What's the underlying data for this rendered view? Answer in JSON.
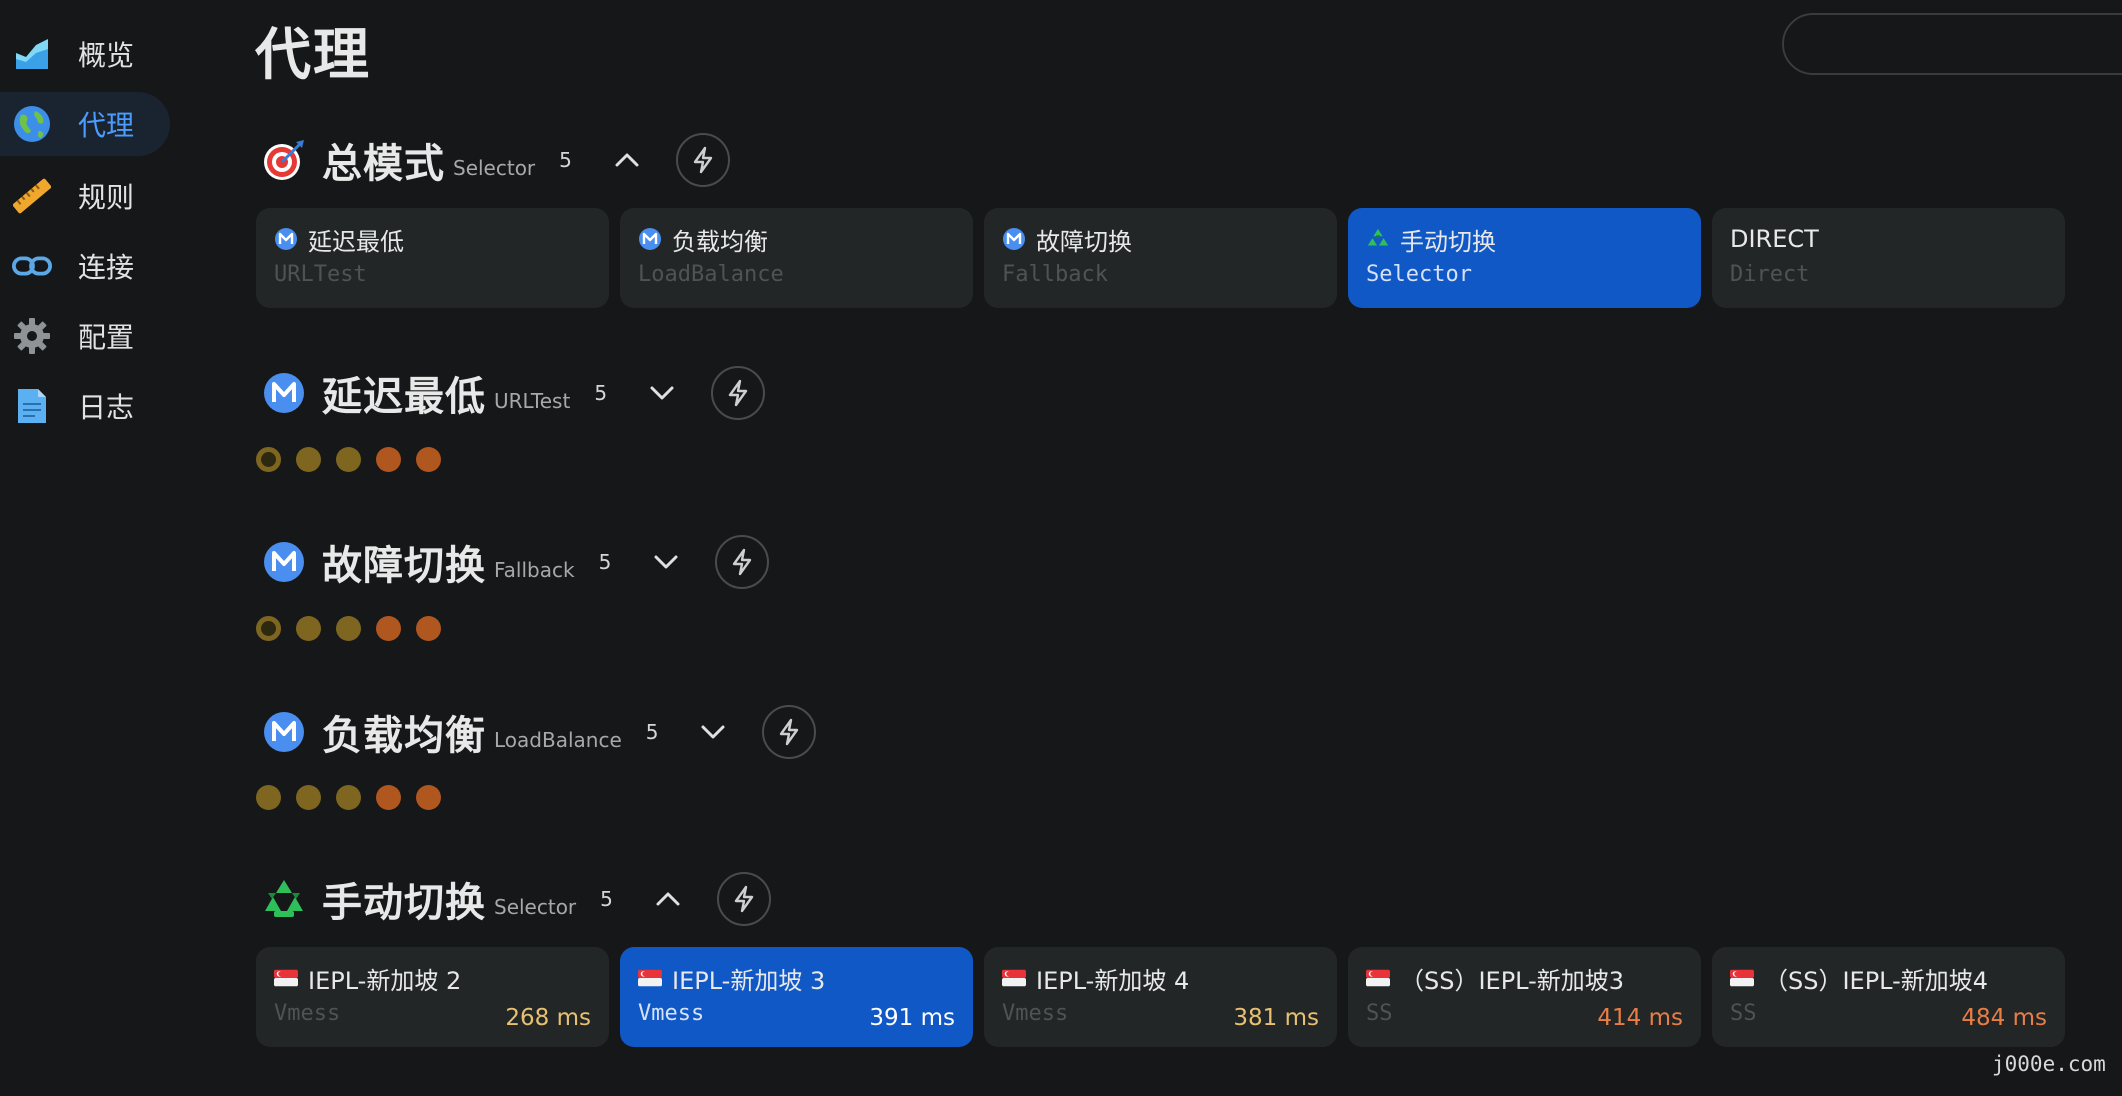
{
  "colors": {
    "bg": "#161718",
    "card": "#232627",
    "selected": "#1158c7",
    "accent": "#4b9cff",
    "delay_yellow": "#e8c170",
    "delay_orange": "#e77e45",
    "dot_yellow": "#7e6620",
    "dot_orange": "#b0561f"
  },
  "sidebar": {
    "items": [
      {
        "label": "概览",
        "icon": "area-chart-icon",
        "active": false
      },
      {
        "label": "代理",
        "icon": "globe-icon",
        "active": true
      },
      {
        "label": "规则",
        "icon": "ruler-icon",
        "active": false
      },
      {
        "label": "连接",
        "icon": "link-icon",
        "active": false
      },
      {
        "label": "配置",
        "icon": "gear-icon",
        "active": false
      },
      {
        "label": "日志",
        "icon": "document-icon",
        "active": false
      }
    ]
  },
  "page": {
    "title": "代理",
    "search_placeholder": ""
  },
  "groups": [
    {
      "name": "总模式",
      "type": "Selector",
      "count": "5",
      "icon": "target-icon",
      "expanded": true,
      "proxies": [
        {
          "name": "延迟最低",
          "sub": "URLTest",
          "icon": "meta-icon",
          "delay": "",
          "selected": false
        },
        {
          "name": "负载均衡",
          "sub": "LoadBalance",
          "icon": "meta-icon",
          "delay": "",
          "selected": false
        },
        {
          "name": "故障切换",
          "sub": "Fallback",
          "icon": "meta-icon",
          "delay": "",
          "selected": false
        },
        {
          "name": "手动切换",
          "sub": "Selector",
          "icon": "recycle-icon",
          "delay": "",
          "selected": true
        },
        {
          "name": "DIRECT",
          "sub": "Direct",
          "icon": "",
          "delay": "",
          "selected": false
        }
      ]
    },
    {
      "name": "延迟最低",
      "type": "URLTest",
      "count": "5",
      "icon": "meta-icon",
      "expanded": false,
      "dots": [
        "ring",
        "yellow",
        "yellow",
        "orange",
        "orange"
      ]
    },
    {
      "name": "故障切换",
      "type": "Fallback",
      "count": "5",
      "icon": "meta-icon",
      "expanded": false,
      "dots": [
        "ring",
        "yellow",
        "yellow",
        "orange",
        "orange"
      ]
    },
    {
      "name": "负载均衡",
      "type": "LoadBalance",
      "count": "5",
      "icon": "meta-icon",
      "expanded": false,
      "dots": [
        "yellow",
        "yellow",
        "yellow",
        "orange",
        "orange"
      ]
    },
    {
      "name": "手动切换",
      "type": "Selector",
      "count": "5",
      "icon": "recycle-icon",
      "expanded": true,
      "proxies": [
        {
          "name": "IEPL-新加坡 2",
          "sub": "Vmess",
          "icon": "singapore-flag-icon",
          "delay": "268 ms",
          "delay_color": "#e8c170",
          "selected": false
        },
        {
          "name": "IEPL-新加坡 3",
          "sub": "Vmess",
          "icon": "singapore-flag-icon",
          "delay": "391 ms",
          "delay_color": "#ffffff",
          "selected": true
        },
        {
          "name": "IEPL-新加坡 4",
          "sub": "Vmess",
          "icon": "singapore-flag-icon",
          "delay": "381 ms",
          "delay_color": "#e8c170",
          "selected": false
        },
        {
          "name": "（SS）IEPL-新加坡3",
          "sub": "SS",
          "icon": "singapore-flag-icon",
          "delay": "414 ms",
          "delay_color": "#e77e45",
          "selected": false
        },
        {
          "name": "（SS）IEPL-新加坡4",
          "sub": "SS",
          "icon": "singapore-flag-icon",
          "delay": "484 ms",
          "delay_color": "#e77e45",
          "selected": false
        }
      ]
    }
  ],
  "watermark": "j000e.com"
}
